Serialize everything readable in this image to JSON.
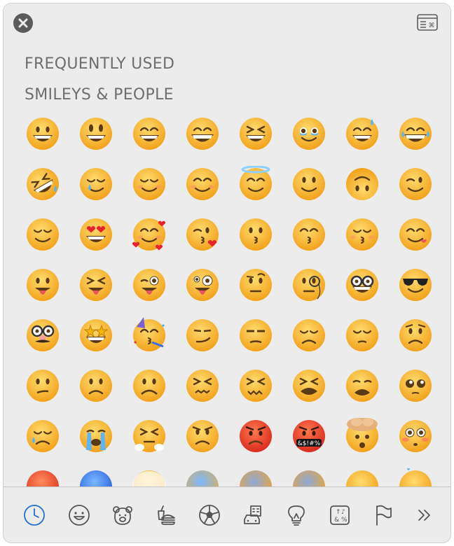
{
  "window": {
    "close_label": "Close",
    "viewer_label": "Show Character Viewer"
  },
  "sections": [
    {
      "title": "FREQUENTLY USED"
    },
    {
      "title": "SMILEYS & PEOPLE"
    }
  ],
  "emojis": [
    {
      "name": "grinning-face",
      "char": "😀"
    },
    {
      "name": "grinning-face-with-big-eyes",
      "char": "😃"
    },
    {
      "name": "grinning-face-with-smiling-eyes",
      "char": "😄"
    },
    {
      "name": "beaming-face-with-smiling-eyes",
      "char": "😁"
    },
    {
      "name": "grinning-squinting-face",
      "char": "😆"
    },
    {
      "name": "face-holding-back-tears",
      "char": "🥹"
    },
    {
      "name": "grinning-face-with-sweat",
      "char": "😅"
    },
    {
      "name": "face-with-tears-of-joy",
      "char": "😂"
    },
    {
      "name": "rolling-on-the-floor-laughing",
      "char": "🤣"
    },
    {
      "name": "smiling-face-with-tear",
      "char": "🥲"
    },
    {
      "name": "smiling-face",
      "char": "☺️"
    },
    {
      "name": "smiling-face-with-smiling-eyes",
      "char": "😊"
    },
    {
      "name": "smiling-face-with-halo",
      "char": "😇"
    },
    {
      "name": "slightly-smiling-face",
      "char": "🙂"
    },
    {
      "name": "upside-down-face",
      "char": "🙃"
    },
    {
      "name": "winking-face",
      "char": "😉"
    },
    {
      "name": "relieved-face",
      "char": "😌"
    },
    {
      "name": "smiling-face-with-heart-eyes",
      "char": "😍"
    },
    {
      "name": "smiling-face-with-hearts",
      "char": "🥰"
    },
    {
      "name": "face-blowing-a-kiss",
      "char": "😘"
    },
    {
      "name": "kissing-face",
      "char": "😗"
    },
    {
      "name": "kissing-face-with-smiling-eyes",
      "char": "😙"
    },
    {
      "name": "kissing-face-with-closed-eyes",
      "char": "😚"
    },
    {
      "name": "face-savoring-food",
      "char": "😋"
    },
    {
      "name": "face-with-tongue",
      "char": "😛"
    },
    {
      "name": "squinting-face-with-tongue",
      "char": "😝"
    },
    {
      "name": "winking-face-with-tongue",
      "char": "😜"
    },
    {
      "name": "zany-face",
      "char": "🤪"
    },
    {
      "name": "face-with-raised-eyebrow",
      "char": "🤨"
    },
    {
      "name": "face-with-monocle",
      "char": "🧐"
    },
    {
      "name": "nerd-face",
      "char": "🤓"
    },
    {
      "name": "smiling-face-with-sunglasses",
      "char": "😎"
    },
    {
      "name": "disguised-face",
      "char": "🥸"
    },
    {
      "name": "star-struck",
      "char": "🤩"
    },
    {
      "name": "partying-face",
      "char": "🥳"
    },
    {
      "name": "smirking-face",
      "char": "😏"
    },
    {
      "name": "unamused-face",
      "char": "😒"
    },
    {
      "name": "disappointed-face",
      "char": "😞"
    },
    {
      "name": "pensive-face",
      "char": "😔"
    },
    {
      "name": "worried-face",
      "char": "😟"
    },
    {
      "name": "confused-face",
      "char": "😕"
    },
    {
      "name": "slightly-frowning-face",
      "char": "🙁"
    },
    {
      "name": "frowning-face",
      "char": "☹️"
    },
    {
      "name": "persevering-face",
      "char": "😣"
    },
    {
      "name": "confounded-face",
      "char": "😖"
    },
    {
      "name": "tired-face",
      "char": "😫"
    },
    {
      "name": "weary-face",
      "char": "😩"
    },
    {
      "name": "pleading-face",
      "char": "🥺"
    },
    {
      "name": "crying-face",
      "char": "😢"
    },
    {
      "name": "loudly-crying-face",
      "char": "😭"
    },
    {
      "name": "face-with-steam-from-nose",
      "char": "😤"
    },
    {
      "name": "angry-face",
      "char": "😠"
    },
    {
      "name": "pouting-face",
      "char": "😡"
    },
    {
      "name": "face-with-symbols-on-mouth",
      "char": "🤬"
    },
    {
      "name": "exploding-head",
      "char": "🤯"
    },
    {
      "name": "flushed-face",
      "char": "😳"
    },
    {
      "name": "hot-face",
      "char": "🥵"
    },
    {
      "name": "cold-face",
      "char": "🥶"
    },
    {
      "name": "face-in-clouds",
      "char": "😶‍🌫️"
    },
    {
      "name": "face-screaming-in-fear",
      "char": "😱"
    },
    {
      "name": "fearful-face",
      "char": "😨"
    },
    {
      "name": "anxious-face-with-sweat",
      "char": "😰"
    },
    {
      "name": "sad-but-relieved-face",
      "char": "😥"
    },
    {
      "name": "downcast-face-with-sweat",
      "char": "😓"
    }
  ],
  "symbols_text": "&$!#%",
  "categories": [
    {
      "name": "frequently-used",
      "label": "Frequently Used",
      "icon": "clock-icon",
      "selected": true
    },
    {
      "name": "smileys-people",
      "label": "Smileys & People",
      "icon": "smiley-icon",
      "selected": false
    },
    {
      "name": "animals-nature",
      "label": "Animals & Nature",
      "icon": "bear-icon",
      "selected": false
    },
    {
      "name": "food-drink",
      "label": "Food & Drink",
      "icon": "burger-cup-icon",
      "selected": false
    },
    {
      "name": "activity",
      "label": "Activity",
      "icon": "soccer-ball-icon",
      "selected": false
    },
    {
      "name": "travel-places",
      "label": "Travel & Places",
      "icon": "car-building-icon",
      "selected": false
    },
    {
      "name": "objects",
      "label": "Objects",
      "icon": "lightbulb-icon",
      "selected": false
    },
    {
      "name": "symbols",
      "label": "Symbols",
      "icon": "symbols-icon",
      "selected": false
    },
    {
      "name": "flags",
      "label": "Flags",
      "icon": "flag-icon",
      "selected": false
    },
    {
      "name": "more",
      "label": "More",
      "icon": "double-chevron-right-icon",
      "selected": false
    }
  ],
  "colors": {
    "face": "#ffc83d",
    "face_dark": "#f2a21b",
    "accent": "#1f6fd6",
    "icon": "#555555"
  }
}
